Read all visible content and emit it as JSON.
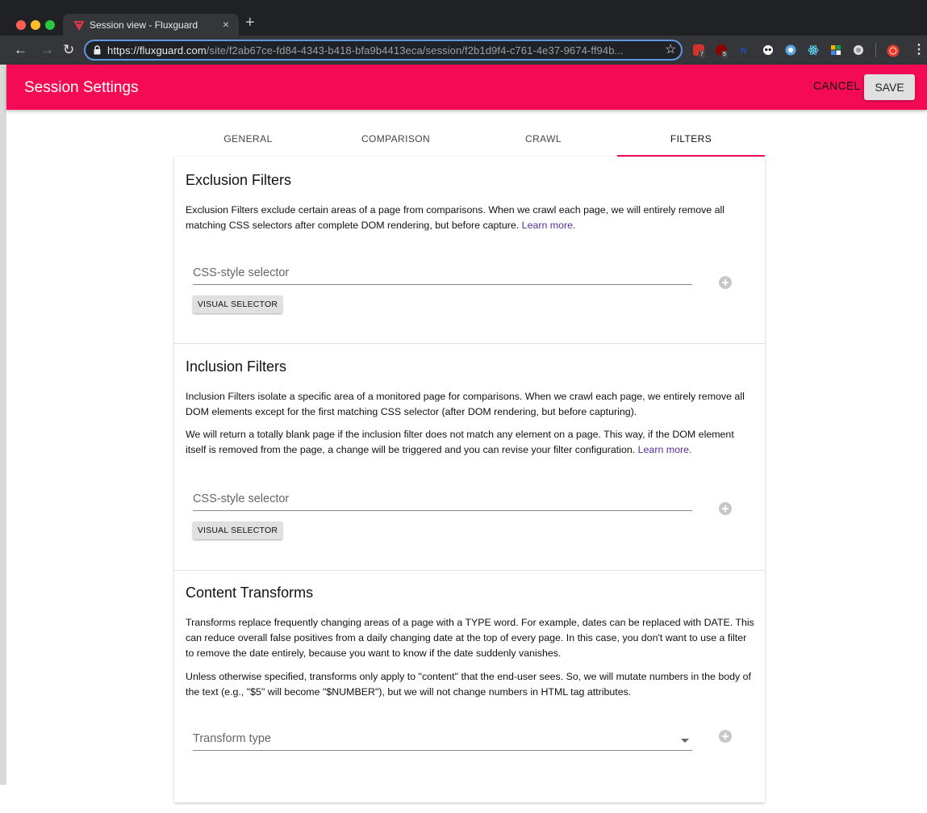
{
  "browser": {
    "tab_title": "Session view - Fluxguard",
    "url_host": "https://fluxguard.com",
    "url_path": "/site/f2ab67ce-fd84-4343-b418-bfa9b4413eca/session/f2b1d9f4-c761-4e37-9674-ff94b...",
    "new_tab_symbol": "+",
    "close_symbol": "×",
    "extension_badges": [
      "7",
      "5"
    ]
  },
  "header": {
    "title": "Session Settings",
    "cancel_label": "CANCEL",
    "save_label": "SAVE",
    "accent_color": "#f50b55"
  },
  "tabs": [
    {
      "label": "GENERAL",
      "active": false
    },
    {
      "label": "COMPARISON",
      "active": false
    },
    {
      "label": "CRAWL",
      "active": false
    },
    {
      "label": "FILTERS",
      "active": true
    }
  ],
  "exclusion": {
    "title": "Exclusion Filters",
    "description": "Exclusion Filters exclude certain areas of a page from comparisons. When we crawl each page, we will entirely remove all matching CSS selectors after complete DOM rendering, but before capture.",
    "learn_more": "Learn more.",
    "input_placeholder": "CSS-style selector",
    "visual_selector_label": "VISUAL SELECTOR"
  },
  "inclusion": {
    "title": "Inclusion Filters",
    "description1": "Inclusion Filters isolate a specific area of a monitored page for comparisons. When we crawl each page, we entirely remove all DOM elements except for the first matching CSS selector (after DOM rendering, but before capturing).",
    "description2": "We will return a totally blank page if the inclusion filter does not match any element on a page. This way, if the DOM element itself is removed from the page, a change will be triggered and you can revise your filter configuration.",
    "learn_more": "Learn more.",
    "input_placeholder": "CSS-style selector",
    "visual_selector_label": "VISUAL SELECTOR"
  },
  "transforms": {
    "title": "Content Transforms",
    "description1": "Transforms replace frequently changing areas of a page with a TYPE word. For example, dates can be replaced with DATE. This can reduce overall false positives from a daily changing date at the top of every page. In this case, you don't want to use a filter to remove the date entirely, because you want to know if the date suddenly vanishes.",
    "description2": "Unless otherwise specified, transforms only apply to \"content\" that the end-user sees. So, we will mutate numbers in the body of the text (e.g., \"$5\" will become \"$NUMBER\"), but we will not change numbers in HTML tag attributes.",
    "select_placeholder": "Transform type"
  }
}
